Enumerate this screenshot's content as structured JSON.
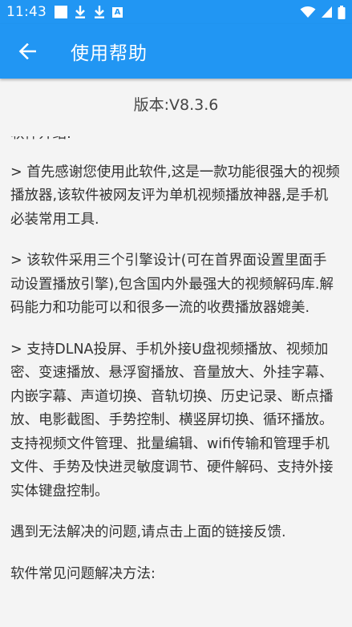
{
  "status_bar": {
    "time": "11:43",
    "icons_left": [
      "square-icon",
      "download-icon",
      "download-icon",
      "a-icon"
    ],
    "icons_right": [
      "wifi-icon",
      "signal-icon",
      "battery-icon"
    ],
    "a_label": "A"
  },
  "app_bar": {
    "title": "使用帮助",
    "back_icon": "arrow-left-icon",
    "color": "#2196f3"
  },
  "version": "版本:V8.3.6",
  "content": {
    "partial_heading": "软件介绍:",
    "paragraphs": [
      "> 首先感谢您使用此软件,这是一款功能很强大的视频播放器,该软件被网友评为单机视频播放神器,是手机必装常用工具.",
      "> 该软件采用三个引擎设计(可在首界面设置里面手动设置播放引擎),包含国内外最强大的视频解码库.解码能力和功能可以和很多一流的收费播放器媲美.",
      "> 支持DLNA投屏、手机外接U盘视频播放、视频加密、变速播放、悬浮窗播放、音量放大、外挂字幕、内嵌字幕、声道切换、音轨切换、历史记录、断点播放、电影截图、手势控制、横竖屏切换、循环播放。支持视频文件管理、批量编辑、wifi传输和管理手机文件、手势及快进灵敏度调节、硬件解码、支持外接实体键盘控制。",
      "遇到无法解决的问题,请点击上面的链接反馈.",
      "软件常见问题解决方法:"
    ]
  }
}
